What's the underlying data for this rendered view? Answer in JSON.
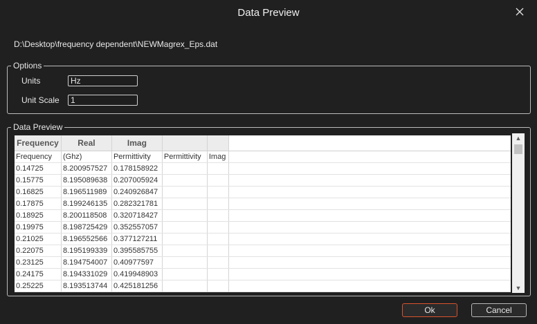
{
  "dialog": {
    "title": "Data Preview",
    "file_path": "D:\\Desktop\\frequency dependent\\NEWMagrex_Eps.dat"
  },
  "options": {
    "legend": "Options",
    "units_label": "Units",
    "units_value": "Hz",
    "unit_scale_label": "Unit Scale",
    "unit_scale_value": "1"
  },
  "preview": {
    "legend": "Data Preview",
    "columns": [
      "Frequency",
      "Real",
      "Imag",
      "",
      "",
      ""
    ],
    "rows": [
      [
        "Frequency",
        "(Ghz)",
        "Permittivity",
        "Permittivity",
        "Imag",
        ""
      ],
      [
        "0.14725",
        "8.200957527",
        "0.178158922",
        "",
        "",
        ""
      ],
      [
        "0.15775",
        "8.195089638",
        "0.207005924",
        "",
        "",
        ""
      ],
      [
        "0.16825",
        "8.196511989",
        "0.240926847",
        "",
        "",
        ""
      ],
      [
        "0.17875",
        "8.199246135",
        "0.282321781",
        "",
        "",
        ""
      ],
      [
        "0.18925",
        "8.200118508",
        "0.320718427",
        "",
        "",
        ""
      ],
      [
        "0.19975",
        "8.198725429",
        "0.352557057",
        "",
        "",
        ""
      ],
      [
        "0.21025",
        "8.196552566",
        "0.377127211",
        "",
        "",
        ""
      ],
      [
        "0.22075",
        "8.195199339",
        "0.395585755",
        "",
        "",
        ""
      ],
      [
        "0.23125",
        "8.194754007",
        "0.40977597",
        "",
        "",
        ""
      ],
      [
        "0.24175",
        "8.194331029",
        "0.419948903",
        "",
        "",
        ""
      ],
      [
        "0.25225",
        "8.193513744",
        "0.425181256",
        "",
        "",
        ""
      ]
    ]
  },
  "buttons": {
    "ok": "Ok",
    "cancel": "Cancel"
  }
}
